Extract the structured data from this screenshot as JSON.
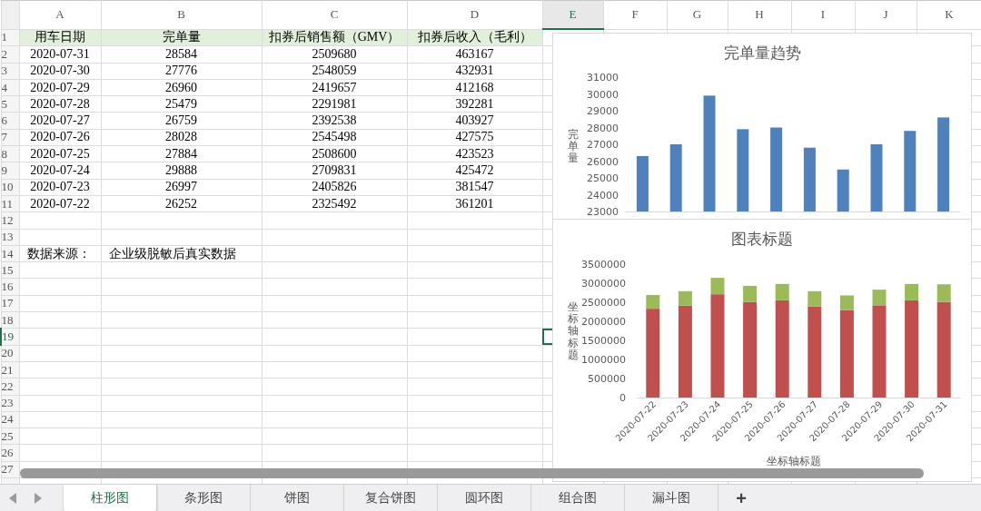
{
  "columns": [
    {
      "label": "A",
      "selected": false
    },
    {
      "label": "B",
      "selected": false
    },
    {
      "label": "C",
      "selected": false
    },
    {
      "label": "D",
      "selected": false
    },
    {
      "label": "E",
      "selected": true
    },
    {
      "label": "F",
      "selected": false
    },
    {
      "label": "G",
      "selected": false
    },
    {
      "label": "H",
      "selected": false
    },
    {
      "label": "I",
      "selected": false
    },
    {
      "label": "J",
      "selected": false
    },
    {
      "label": "K",
      "selected": false
    }
  ],
  "rows": [
    {
      "number": "1",
      "selected": false,
      "kind": "header",
      "cells": [
        "用车日期",
        "完单量",
        "扣券后销售额（GMV）",
        "扣券后收入（毛利）"
      ]
    },
    {
      "number": "2",
      "selected": false,
      "kind": "data",
      "cells": [
        "2020-07-31",
        "28584",
        "2509680",
        "463167"
      ]
    },
    {
      "number": "3",
      "selected": false,
      "kind": "data",
      "cells": [
        "2020-07-30",
        "27776",
        "2548059",
        "432931"
      ]
    },
    {
      "number": "4",
      "selected": false,
      "kind": "data",
      "cells": [
        "2020-07-29",
        "26960",
        "2419657",
        "412168"
      ]
    },
    {
      "number": "5",
      "selected": false,
      "kind": "data",
      "cells": [
        "2020-07-28",
        "25479",
        "2291981",
        "392281"
      ]
    },
    {
      "number": "6",
      "selected": false,
      "kind": "data",
      "cells": [
        "2020-07-27",
        "26759",
        "2392538",
        "403927"
      ]
    },
    {
      "number": "7",
      "selected": false,
      "kind": "data",
      "cells": [
        "2020-07-26",
        "28028",
        "2545498",
        "427575"
      ]
    },
    {
      "number": "8",
      "selected": false,
      "kind": "data",
      "cells": [
        "2020-07-25",
        "27884",
        "2508600",
        "423523"
      ]
    },
    {
      "number": "9",
      "selected": false,
      "kind": "data",
      "cells": [
        "2020-07-24",
        "29888",
        "2709831",
        "425472"
      ]
    },
    {
      "number": "10",
      "selected": false,
      "kind": "data",
      "cells": [
        "2020-07-23",
        "26997",
        "2405826",
        "381547"
      ]
    },
    {
      "number": "11",
      "selected": false,
      "kind": "data",
      "cells": [
        "2020-07-22",
        "26252",
        "2325492",
        "361201"
      ]
    },
    {
      "number": "12",
      "selected": false
    },
    {
      "number": "13",
      "selected": false
    },
    {
      "number": "14",
      "selected": false,
      "kind": "note",
      "cells": [
        "数据来源：",
        "企业级脱敏后真实数据"
      ]
    },
    {
      "number": "15",
      "selected": false
    },
    {
      "number": "16",
      "selected": false
    },
    {
      "number": "17",
      "selected": false
    },
    {
      "number": "18",
      "selected": false
    },
    {
      "number": "19",
      "selected": true
    },
    {
      "number": "20",
      "selected": false
    },
    {
      "number": "21",
      "selected": false
    },
    {
      "number": "22",
      "selected": false
    },
    {
      "number": "23",
      "selected": false
    },
    {
      "number": "24",
      "selected": false
    },
    {
      "number": "25",
      "selected": false
    },
    {
      "number": "26",
      "selected": false
    },
    {
      "number": "27",
      "selected": false
    }
  ],
  "charts": [
    {
      "chart_data": {
        "type": "bar",
        "title": "完单量趋势",
        "ylabel": "完单量",
        "ylim": [
          23000,
          31000
        ],
        "yticks": [
          23000,
          24000,
          25000,
          26000,
          27000,
          28000,
          29000,
          30000,
          31000
        ],
        "series": [
          {
            "color": "#4f81bd",
            "values": [
              26300,
              27000,
              29900,
              27900,
              28000,
              26800,
              25500,
              27000,
              27800,
              28600
            ]
          }
        ]
      }
    },
    {
      "chart_data": {
        "type": "bar",
        "title": "图表标题",
        "xlabel": "坐标轴标题",
        "ylabel": "坐标轴标题",
        "stacked": true,
        "ylim": [
          0,
          3500000
        ],
        "yticks": [
          0,
          500000,
          1000000,
          1500000,
          2000000,
          2500000,
          3000000,
          3500000
        ],
        "categories": [
          "2020-07-22",
          "2020-07-23",
          "2020-07-24",
          "2020-07-25",
          "2020-07-26",
          "2020-07-27",
          "2020-07-28",
          "2020-07-29",
          "2020-07-30",
          "2020-07-31"
        ],
        "series": [
          {
            "color": "#c0504d",
            "values": [
              2330000,
              2410000,
              2710000,
              2510000,
              2550000,
              2390000,
              2290000,
              2420000,
              2550000,
              2510000
            ]
          },
          {
            "color": "#9bbb59",
            "values": [
              360000,
              380000,
              430000,
              420000,
              430000,
              400000,
              390000,
              410000,
              430000,
              460000
            ]
          }
        ]
      }
    }
  ],
  "sheet_tabs": [
    {
      "label": "柱形图",
      "selected": true
    },
    {
      "label": "条形图",
      "selected": false
    },
    {
      "label": "饼图",
      "selected": false
    },
    {
      "label": "复合饼图",
      "selected": false
    },
    {
      "label": "圆环图",
      "selected": false
    },
    {
      "label": "组合图",
      "selected": false
    },
    {
      "label": "漏斗图",
      "selected": false
    }
  ],
  "add_sheet_button": "+"
}
